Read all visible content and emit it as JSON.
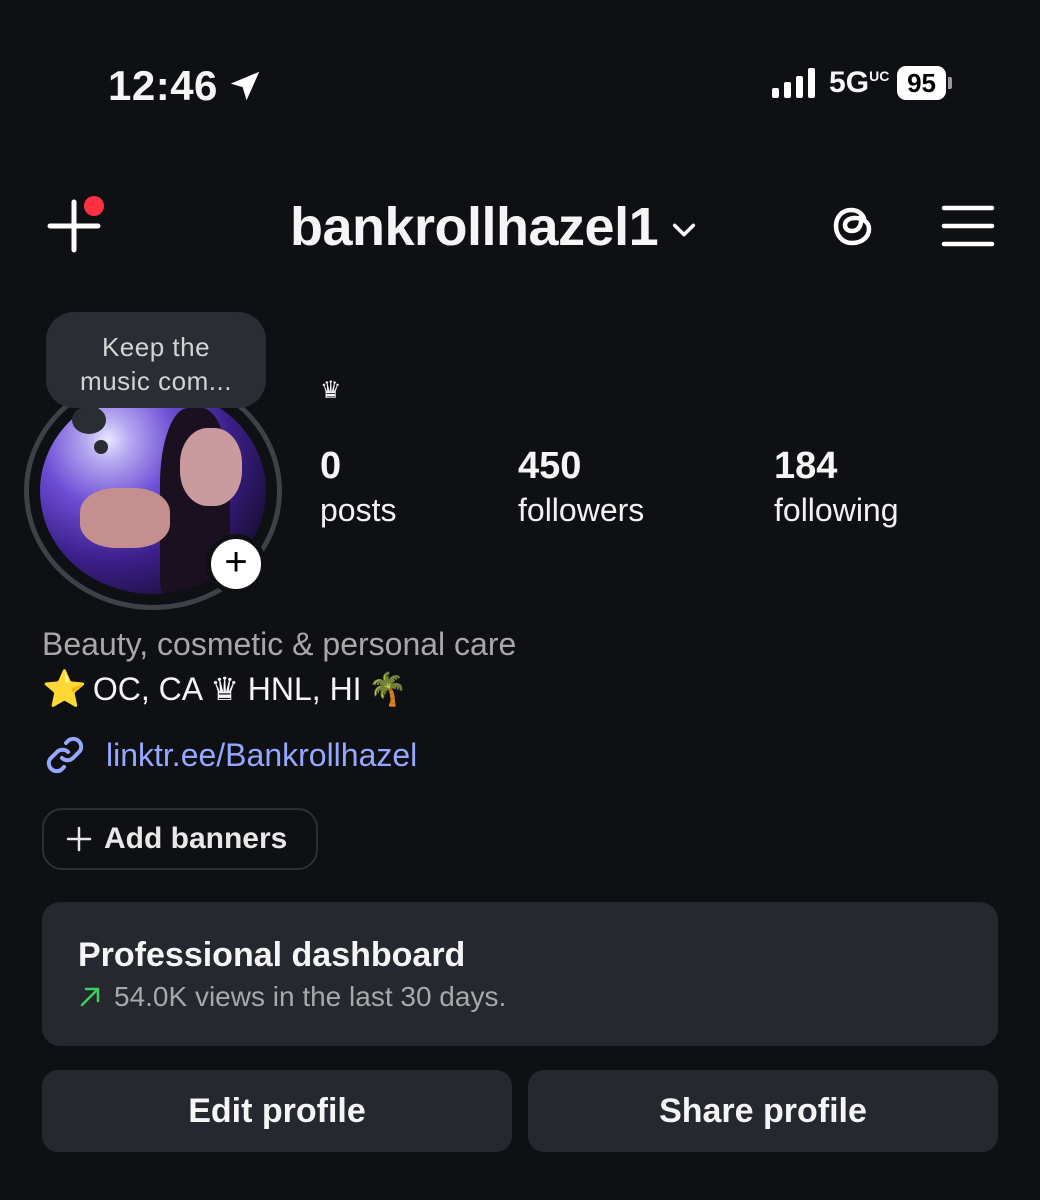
{
  "status_bar": {
    "time": "12:46",
    "location_icon": "location-arrow-icon",
    "network": "5G",
    "network_suffix": "UC",
    "battery": "95"
  },
  "header": {
    "username": "bankrollhazel1",
    "create_icon": "plus-icon",
    "notification_dot_color": "#ff3040",
    "dropdown_icon": "chevron-down-icon",
    "threads_icon": "threads-icon",
    "menu_icon": "hamburger-menu-icon"
  },
  "profile": {
    "note": "Keep the music com...",
    "name_emoji": "♛",
    "add_story_label": "+",
    "stats": [
      {
        "value": "0",
        "label": "posts"
      },
      {
        "value": "450",
        "label": "followers"
      },
      {
        "value": "184",
        "label": "following"
      }
    ],
    "category": "Beauty, cosmetic & personal care",
    "bio": {
      "star": "⭐",
      "text": "OC, CA ♛ HNL, HI",
      "palm": "🌴"
    },
    "link": "linktr.ee/Bankrollhazel"
  },
  "banners": {
    "label": "Add banners"
  },
  "dashboard": {
    "title": "Professional dashboard",
    "subtitle": "54.0K views in the last 30 days.",
    "trend_color": "#3ecf5a"
  },
  "actions": {
    "edit": "Edit profile",
    "share": "Share profile"
  }
}
